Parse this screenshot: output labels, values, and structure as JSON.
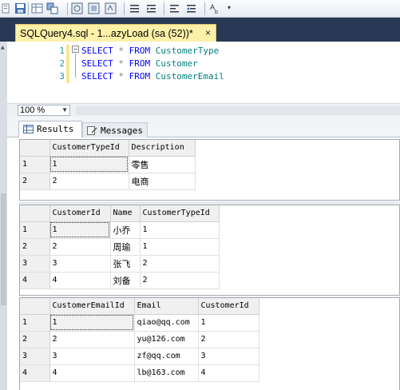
{
  "toolbar": {
    "icons": [
      "bracket-icon",
      "save-icon",
      "grid-icon",
      "results-grid-icon",
      "results-file-icon",
      "display-plan-icon",
      "comment-icon",
      "uncomment-icon",
      "outdent-icon",
      "indent-icon",
      "font-icon"
    ]
  },
  "tab": {
    "title": "SQLQuery4.sql - 1...azyLoad (sa (52))*",
    "close": "×"
  },
  "editor": {
    "lines": [
      {
        "num": "1",
        "kw1": "SELECT",
        "star": "*",
        "kw2": "FROM",
        "table": "CustomerType"
      },
      {
        "num": "2",
        "kw1": "SELECT",
        "star": "*",
        "kw2": "FROM",
        "table": "Customer"
      },
      {
        "num": "3",
        "kw1": "SELECT",
        "star": "*",
        "kw2": "FROM",
        "table": "CustomerEmail"
      }
    ]
  },
  "zoom": {
    "value": "100 %"
  },
  "result_tabs": {
    "results": "Results",
    "messages": "Messages"
  },
  "grids": [
    {
      "columns": [
        "CustomerTypeId",
        "Description"
      ],
      "rows": [
        {
          "rn": "1",
          "cells": [
            "1",
            "零售"
          ]
        },
        {
          "rn": "2",
          "cells": [
            "2",
            "电商"
          ]
        }
      ]
    },
    {
      "columns": [
        "CustomerId",
        "Name",
        "CustomerTypeId"
      ],
      "rows": [
        {
          "rn": "1",
          "cells": [
            "1",
            "小乔",
            "1"
          ]
        },
        {
          "rn": "2",
          "cells": [
            "2",
            "周瑜",
            "1"
          ]
        },
        {
          "rn": "3",
          "cells": [
            "3",
            "张飞",
            "2"
          ]
        },
        {
          "rn": "4",
          "cells": [
            "4",
            "刘备",
            "2"
          ]
        }
      ]
    },
    {
      "columns": [
        "CustomerEmailId",
        "Email",
        "CustomerId"
      ],
      "rows": [
        {
          "rn": "1",
          "cells": [
            "1",
            "qiao@qq.com",
            "1"
          ]
        },
        {
          "rn": "2",
          "cells": [
            "2",
            "yu@126.com",
            "2"
          ]
        },
        {
          "rn": "3",
          "cells": [
            "3",
            "zf@qq.com",
            "3"
          ]
        },
        {
          "rn": "4",
          "cells": [
            "4",
            "lb@163.com",
            "4"
          ]
        }
      ]
    }
  ],
  "colors": {
    "tab_active": "#fff1a8",
    "keyword": "#0000ff",
    "identifier": "#008080",
    "line_number": "#2b91af",
    "well": "#293955"
  }
}
